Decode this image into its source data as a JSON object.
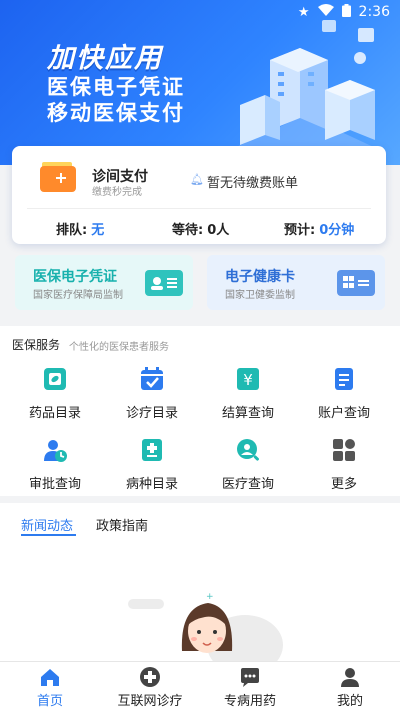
{
  "status_bar": {
    "time": "2:36"
  },
  "banner": {
    "headline": "加快应用",
    "line1": "医保电子凭证",
    "line2": "移动医保支付"
  },
  "payment": {
    "title": "诊间支付",
    "subtitle": "缴费秒完成",
    "bill_notice": "暂无待缴费账单",
    "queue_label": "排队:",
    "queue_value": "无",
    "waiting_label": "等待:",
    "waiting_value": "0人",
    "estimate_label": "预计:",
    "estimate_value": "0分钟"
  },
  "cards": [
    {
      "title": "医保电子凭证",
      "subtitle": "国家医疗保障局监制",
      "icon": "id-card-icon",
      "color": "#18b1ad"
    },
    {
      "title": "电子健康卡",
      "subtitle": "国家卫健委监制",
      "icon": "qr-card-icon",
      "color": "#2f6fd6"
    }
  ],
  "services": {
    "title": "医保服务",
    "subtitle": "个性化的医保患者服务",
    "items": [
      {
        "label": "药品目录",
        "icon": "medicine-icon"
      },
      {
        "label": "诊疗目录",
        "icon": "calendar-check-icon"
      },
      {
        "label": "结算查询",
        "icon": "yuan-icon"
      },
      {
        "label": "账户查询",
        "icon": "account-icon"
      },
      {
        "label": "审批查询",
        "icon": "approval-icon"
      },
      {
        "label": "病种目录",
        "icon": "document-plus-icon"
      },
      {
        "label": "医疗查询",
        "icon": "search-person-icon"
      },
      {
        "label": "更多",
        "icon": "more-grid-icon"
      }
    ]
  },
  "news": {
    "tabs": [
      {
        "label": "新闻动态",
        "active": true
      },
      {
        "label": "政策指南",
        "active": false
      }
    ]
  },
  "bottom_nav": [
    {
      "label": "首页",
      "icon": "home-icon",
      "active": true
    },
    {
      "label": "互联网诊疗",
      "icon": "plus-circle-icon",
      "active": false
    },
    {
      "label": "专病用药",
      "icon": "chat-icon",
      "active": false
    },
    {
      "label": "我的",
      "icon": "person-icon",
      "active": false
    }
  ],
  "colors": {
    "primary": "#2d7bef",
    "teal": "#18b1ad",
    "banner_start": "#1d63f0",
    "banner_end": "#57a8ff"
  }
}
